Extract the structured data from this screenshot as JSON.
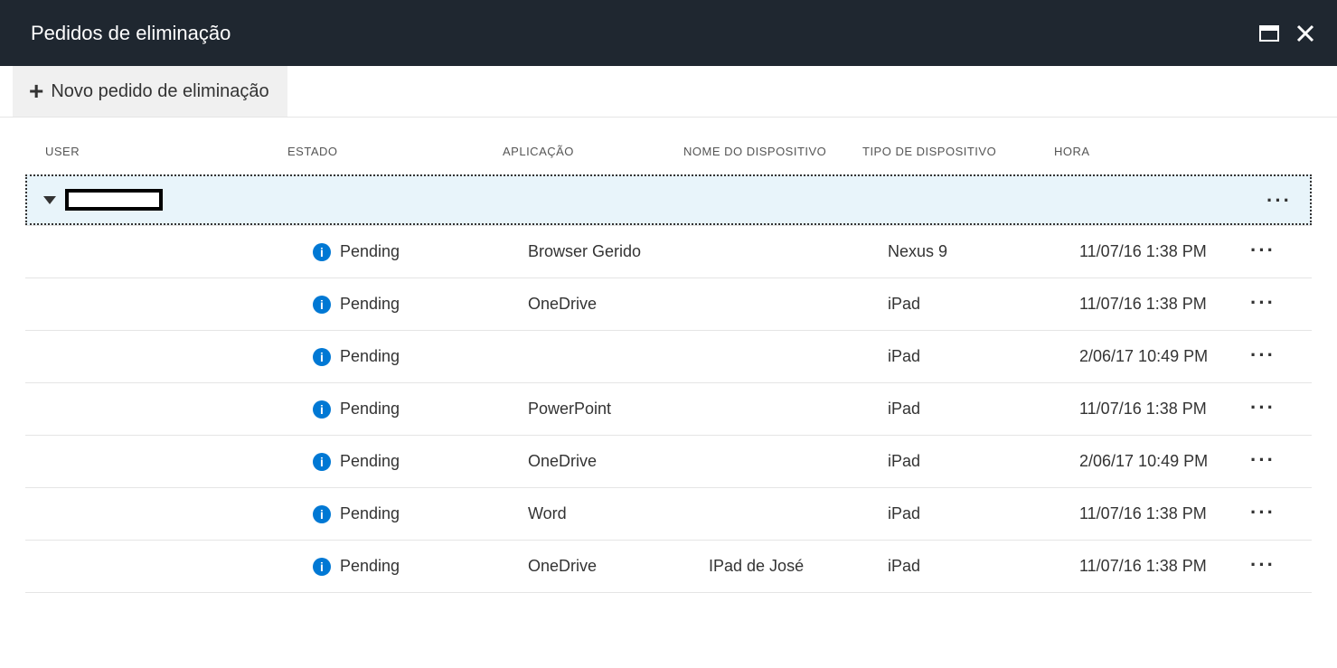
{
  "header": {
    "title": "Pedidos de eliminação"
  },
  "toolbar": {
    "new_request_label": "Novo pedido de eliminação"
  },
  "columns": {
    "user": "USER",
    "estado": "ESTADO",
    "aplicacao": "APLICAÇÃO",
    "nome_dispositivo": "NOME DO DISPOSITIVO",
    "tipo_dispositivo": "TIPO DE DISPOSITIVO",
    "hora": "HORA"
  },
  "rows": [
    {
      "status": "Pending",
      "app": "Browser Gerido",
      "device_name": "",
      "device_type": "Nexus 9",
      "time": "11/07/16 1:38 PM"
    },
    {
      "status": "Pending",
      "app": "OneDrive",
      "device_name": "",
      "device_type": "iPad",
      "time": "11/07/16 1:38 PM"
    },
    {
      "status": "Pending",
      "app": "",
      "device_name": "",
      "device_type": "iPad",
      "time": "2/06/17 10:49 PM"
    },
    {
      "status": "Pending",
      "app": "PowerPoint",
      "device_name": "",
      "device_type": "iPad",
      "time": "11/07/16 1:38 PM"
    },
    {
      "status": "Pending",
      "app": "OneDrive",
      "device_name": "",
      "device_type": "iPad",
      "time": "2/06/17 10:49 PM"
    },
    {
      "status": "Pending",
      "app": "Word",
      "device_name": "",
      "device_type": "iPad",
      "time": "11/07/16 1:38 PM"
    },
    {
      "status": "Pending",
      "app": "OneDrive",
      "device_name": "IPad de José",
      "device_type": "iPad",
      "time": "11/07/16 1:38 PM"
    }
  ]
}
